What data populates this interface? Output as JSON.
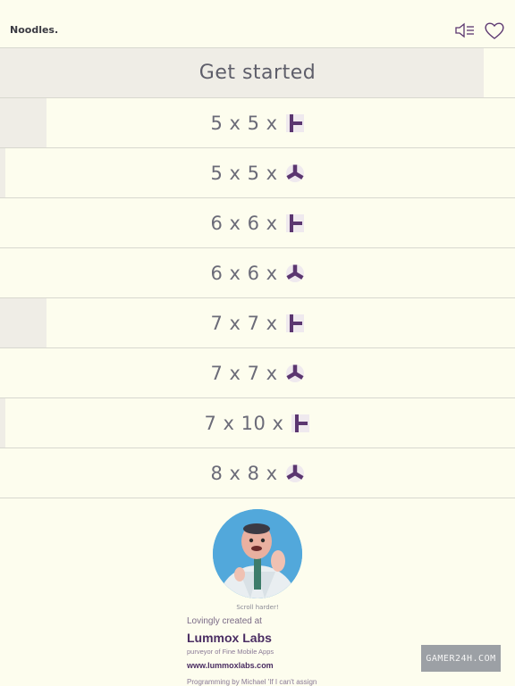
{
  "app": {
    "title": "Noodles."
  },
  "header": {
    "sound_icon": "speaker-icon",
    "favorite_icon": "heart-icon"
  },
  "start": {
    "label": "Get started",
    "progress": 0.94
  },
  "puzzles": [
    {
      "label": "5 x 5 x",
      "shape": "t-piece-icon",
      "progress": 0.09
    },
    {
      "label": "5 x 5 x",
      "shape": "tri-piece-icon",
      "progress": 0.01
    },
    {
      "label": "6 x 6 x",
      "shape": "t-piece-icon",
      "progress": 0.0
    },
    {
      "label": "6 x 6 x",
      "shape": "tri-piece-icon",
      "progress": 0.0
    },
    {
      "label": "7 x 7 x",
      "shape": "t-piece-icon",
      "progress": 0.09
    },
    {
      "label": "7 x 7 x",
      "shape": "tri-piece-icon",
      "progress": 0.0
    },
    {
      "label": "7 x 10 x",
      "shape": "t-piece-icon",
      "progress": 0.01
    },
    {
      "label": "8 x 8 x",
      "shape": "tri-piece-icon",
      "progress": 0.0
    }
  ],
  "footer": {
    "scroll_hint": "Scroll harder!",
    "created": "Lovingly created at",
    "company": "Lummox Labs",
    "tagline": "purveyor of Fine Mobile Apps",
    "url": "www.lummoxlabs.com",
    "credits": "Programming by Michael 'If I can't assign"
  },
  "watermark": "GAMER24H.COM",
  "colors": {
    "background": "#fdfdee",
    "accent": "#5b3670",
    "text": "#6b6b78",
    "progress": "#efede6"
  }
}
